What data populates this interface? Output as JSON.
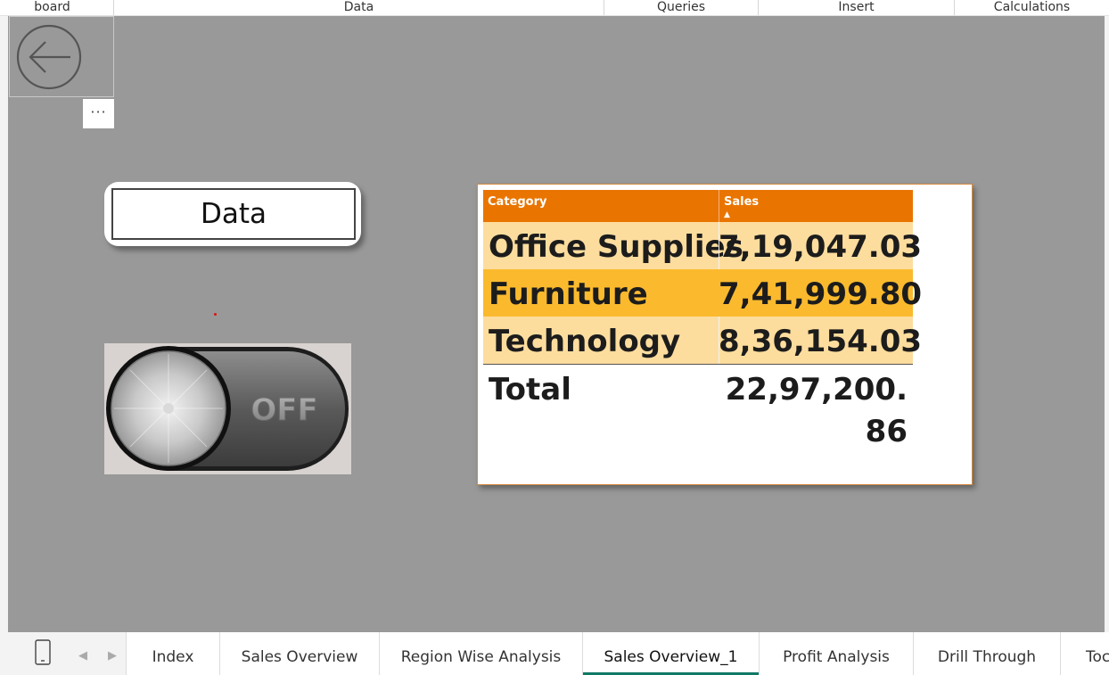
{
  "ribbon": {
    "groups": [
      "board",
      "Data",
      "Queries",
      "Insert",
      "Calculations"
    ]
  },
  "canvas": {
    "more_label": "···",
    "data_button_label": "Data",
    "toggle_state": "OFF"
  },
  "table": {
    "headers": [
      "Category",
      "Sales"
    ],
    "rows": [
      {
        "category": "Office Supplies",
        "sales": "7,19,047.03"
      },
      {
        "category": "Furniture",
        "sales": "7,41,999.80"
      },
      {
        "category": "Technology",
        "sales": "8,36,154.03"
      }
    ],
    "total_label": "Total",
    "total_value": "22,97,200.86"
  },
  "colors": {
    "header_bg": "#e97500",
    "row_light": "#fddd9e",
    "row_highlight": "#fbba2e",
    "canvas_bg": "#999999",
    "active_tab_underline": "#117865"
  },
  "tabs": [
    "Index",
    "Sales Overview",
    "Region Wise Analysis",
    "Sales Overview_1",
    "Profit Analysis",
    "Drill Through",
    "Toc"
  ],
  "active_tab": "Sales Overview_1"
}
